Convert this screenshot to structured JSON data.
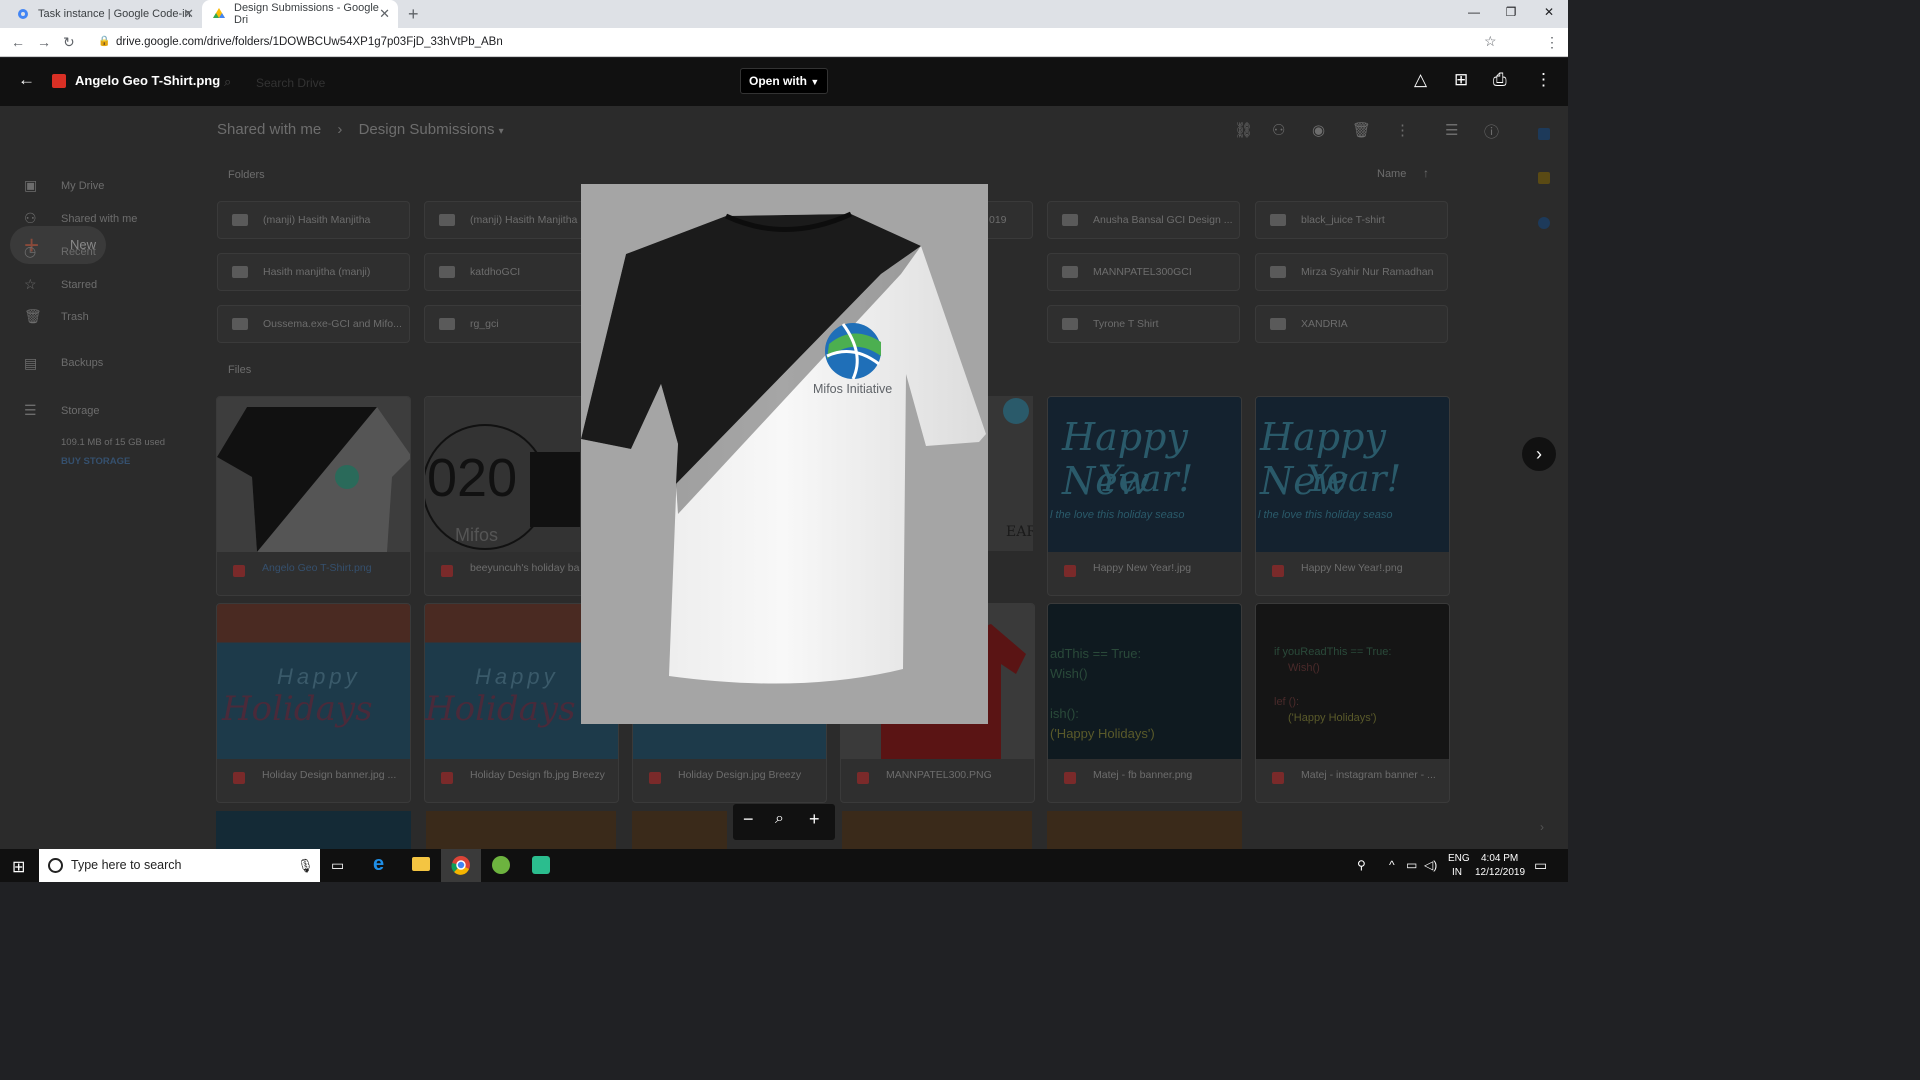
{
  "browser": {
    "tabs": [
      {
        "title": "Task instance | Google Code-in",
        "icon": "gear-icon"
      },
      {
        "title": "Design Submissions - Google Dri",
        "icon": "drive-icon"
      }
    ],
    "url": "drive.google.com/drive/folders/1DOWBCUw54XP1g7p03FjD_33hVtPb_ABn"
  },
  "viewer": {
    "file_title": "Angelo Geo T-Shirt.png",
    "open_with": "Open with",
    "search_placeholder": "Search Drive"
  },
  "drive": {
    "new_label": "New",
    "nav": [
      "My Drive",
      "Shared with me",
      "Recent",
      "Starred",
      "Trash",
      "Backups",
      "Storage"
    ],
    "storage_used": "109.1 MB of 15 GB used",
    "buy_storage": "BUY STORAGE",
    "breadcrumb": [
      "Shared with me",
      "Design Submissions"
    ],
    "folders_label": "Folders",
    "files_label": "Files",
    "sort_label": "Name",
    "folders": [
      "(manji) Hasith Manjitha",
      "(manji) Hasith Manjitha",
      "019",
      "Anusha Bansal GCI Design ...",
      "black_juice T-shirt",
      "Hasith manjitha (manji)",
      "katdhoGCI",
      "MANNPATEL300GCI",
      "Mirza Syahir Nur Ramadhan",
      "Oussema.exe-GCI and Mifo...",
      "rg_gci",
      "Tyrone T Shirt",
      "XANDRIA"
    ],
    "files": [
      "Angelo Geo T-Shirt.png",
      "beeyuncuh's holiday ba",
      "Happy New Year!.jpg",
      "Happy New Year!.png",
      "Holiday Design banner.jpg ...",
      "Holiday Design fb.jpg Breezy",
      "Holiday Design.jpg Breezy",
      "MANNPATEL300.PNG",
      "Matej - fb banner.png",
      "Matej - instagram banner - ..."
    ],
    "thumb_texts": {
      "hny_line1": "Happy New",
      "hny_line2": "Year!",
      "hny_sub": "l the love this holiday seaso",
      "holidays_line1": "Happy",
      "holidays_line2": "Holidays",
      "code_a": "adThis == True:",
      "code_b": "Wish()",
      "code_c": "ish():",
      "code_d": "('Happy Holidays')",
      "code_e": "if youReadThis == True:",
      "code_f": "Wish()",
      "code_g": "lef ():",
      "code_h": "('Happy Holidays')",
      "year_text": "020",
      "mifos_small": "Mifos"
    }
  },
  "preview": {
    "logo_text": "Mifos Initiative"
  },
  "taskbar": {
    "search_placeholder": "Type here to search",
    "lang": "ENG",
    "region": "IN",
    "time": "4:04 PM",
    "date": "12/12/2019"
  },
  "colors": {
    "chrome_tabbar": "#dee1e6",
    "viewer_bar": "#111111",
    "dim_bg": "#2b2b2b",
    "preview_bg": "#a5a5a5"
  }
}
